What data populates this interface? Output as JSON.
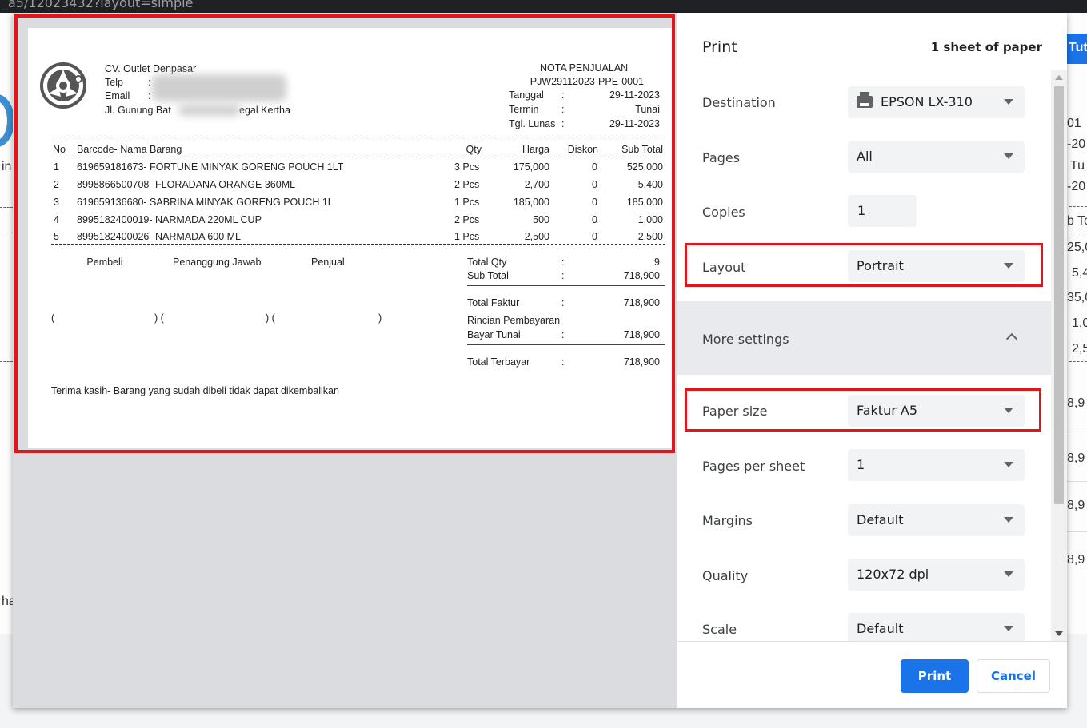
{
  "browser": {
    "url_fragment": "_a5/12023432?layout=simple"
  },
  "background_page": {
    "left_texts": [
      "in",
      "ha"
    ],
    "tutorial_button": "Tut",
    "right_texts": [
      "01",
      "-20",
      "Tu",
      "-20",
      "b To",
      "25,0",
      "5,4",
      "35,0",
      "1,0",
      "2,5",
      "8,9",
      "8,9",
      "8,9",
      "8,9"
    ]
  },
  "print_dialog": {
    "title": "Print",
    "sheet_count": "1 sheet of paper",
    "settings": {
      "destination": {
        "label": "Destination",
        "value": "EPSON LX-310",
        "icon": "printer-icon"
      },
      "pages": {
        "label": "Pages",
        "value": "All"
      },
      "copies": {
        "label": "Copies",
        "value": "1"
      },
      "layout": {
        "label": "Layout",
        "value": "Portrait"
      },
      "more_settings": {
        "label": "More settings"
      },
      "paper_size": {
        "label": "Paper size",
        "value": "Faktur A5"
      },
      "pages_per_sheet": {
        "label": "Pages per sheet",
        "value": "1"
      },
      "margins": {
        "label": "Margins",
        "value": "Default"
      },
      "quality": {
        "label": "Quality",
        "value": "120x72 dpi"
      },
      "scale": {
        "label": "Scale",
        "value": "Default"
      }
    },
    "buttons": {
      "print": "Print",
      "cancel": "Cancel"
    }
  },
  "invoice": {
    "company": {
      "name": "CV. Outlet Denpasar",
      "telp_label": "Telp",
      "email_label": "Email",
      "colon": ":",
      "address_left": "Jl. Gunung Bat",
      "address_right": "egal Kertha"
    },
    "doc_title": "NOTA PENJUALAN",
    "doc_number": "PJW29112023-PPE-0001",
    "meta": [
      {
        "label": "Tanggal",
        "sep": ":",
        "value": "29-11-2023"
      },
      {
        "label": "Termin",
        "sep": ":",
        "value": "Tunai"
      },
      {
        "label": "Tgl. Lunas",
        "sep": ":",
        "value": "29-11-2023"
      }
    ],
    "columns": {
      "no": "No",
      "item": "Barcode- Nama Barang",
      "qty": "Qty",
      "price": "Harga",
      "discount": "Diskon",
      "subtotal": "Sub Total"
    },
    "items": [
      {
        "no": "1",
        "item": "619659181673- FORTUNE MINYAK GORENG POUCH 1LT",
        "qty": "3 Pcs",
        "price": "175,000",
        "discount": "0",
        "subtotal": "525,000"
      },
      {
        "no": "2",
        "item": "8998866500708- FLORADANA ORANGE 360ML",
        "qty": "2 Pcs",
        "price": "2,700",
        "discount": "0",
        "subtotal": "5,400"
      },
      {
        "no": "3",
        "item": "619659136680- SABRINA MINYAK GORENG POUCH 1L",
        "qty": "1 Pcs",
        "price": "185,000",
        "discount": "0",
        "subtotal": "185,000"
      },
      {
        "no": "4",
        "item": "8995182400019- NARMADA 220ML CUP",
        "qty": "2 Pcs",
        "price": "500",
        "discount": "0",
        "subtotal": "1,000"
      },
      {
        "no": "5",
        "item": "8995182400026- NARMADA 600 ML",
        "qty": "1 Pcs",
        "price": "2,500",
        "discount": "0",
        "subtotal": "2,500"
      }
    ],
    "signatures": {
      "buyer": "Pembeli",
      "responsible": "Penanggung Jawab",
      "seller": "Penjual",
      "paren_open": "(",
      "paren_mid": ") (",
      "paren_close": ")"
    },
    "totals": [
      {
        "label": "Total Qty",
        "sep": ":",
        "value": "9"
      },
      {
        "label": "Sub Total",
        "sep": ":",
        "value": "718,900"
      },
      {
        "label": "Total Faktur",
        "sep": ":",
        "value": "718,900"
      },
      {
        "label": "Rincian Pembayaran",
        "sep": "",
        "value": ""
      },
      {
        "label": "Bayar Tunai",
        "sep": ":",
        "value": "718,900"
      },
      {
        "label": "Total Terbayar",
        "sep": ":",
        "value": "718,900"
      }
    ],
    "footer_note": "Terima kasih- Barang yang sudah dibeli tidak dapat dikembalikan"
  }
}
